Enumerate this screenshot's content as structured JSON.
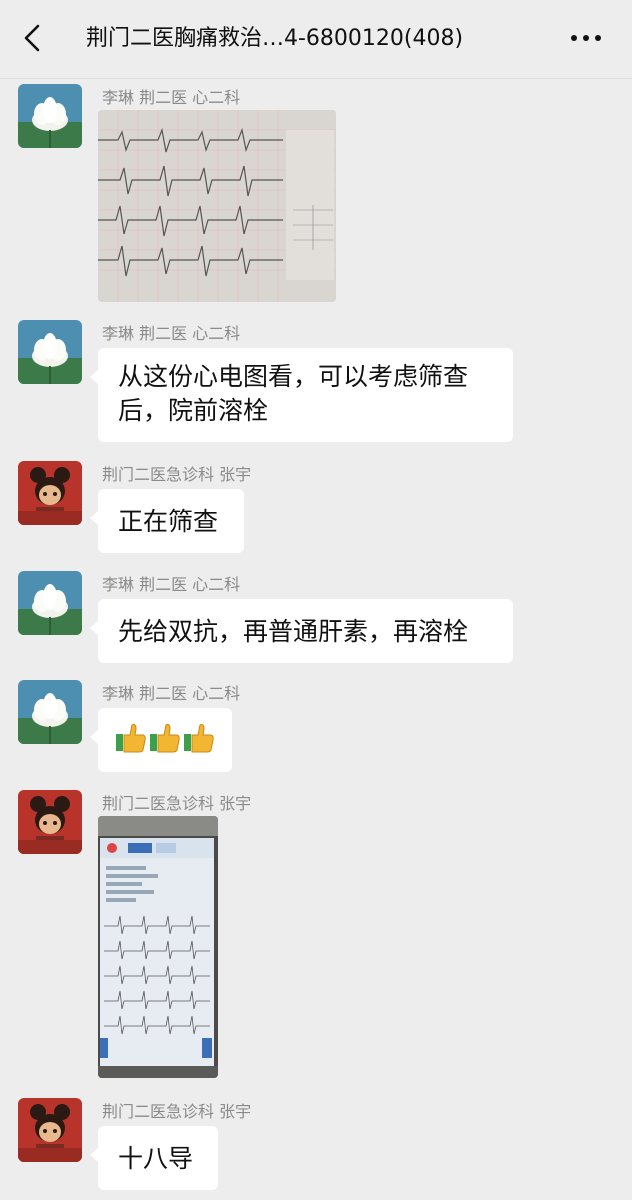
{
  "header": {
    "title": "荆门二医胸痛救治…4-6800120(408)",
    "back_icon": "chevron-left-icon",
    "more_icon": "more-horizontal-icon"
  },
  "messages": [
    {
      "sender": "李琳 荆二医 心二科",
      "type": "image",
      "image": "ecg-paper-photo"
    },
    {
      "sender": "李琳 荆二医 心二科",
      "type": "text",
      "text_line1": "从这份心电图看，可以考虑筛查",
      "text_line2": "后，院前溶栓"
    },
    {
      "sender": "荆门二医急诊科 张宇",
      "type": "text",
      "text": "正在筛查"
    },
    {
      "sender": "李琳 荆二医 心二科",
      "type": "text",
      "text": "先给双抗，再普通肝素，再溶栓"
    },
    {
      "sender": "李琳 荆二医 心二科",
      "type": "emoji",
      "emoji": "👍👍👍"
    },
    {
      "sender": "荆门二医急诊科 张宇",
      "type": "image",
      "image": "ecg-monitor-screen-photo"
    },
    {
      "sender": "荆门二医急诊科 张宇",
      "type": "text",
      "text": "十八导"
    }
  ],
  "colors": {
    "background": "#ededed",
    "bubble": "#ffffff",
    "name_text": "#8a8a8a"
  }
}
